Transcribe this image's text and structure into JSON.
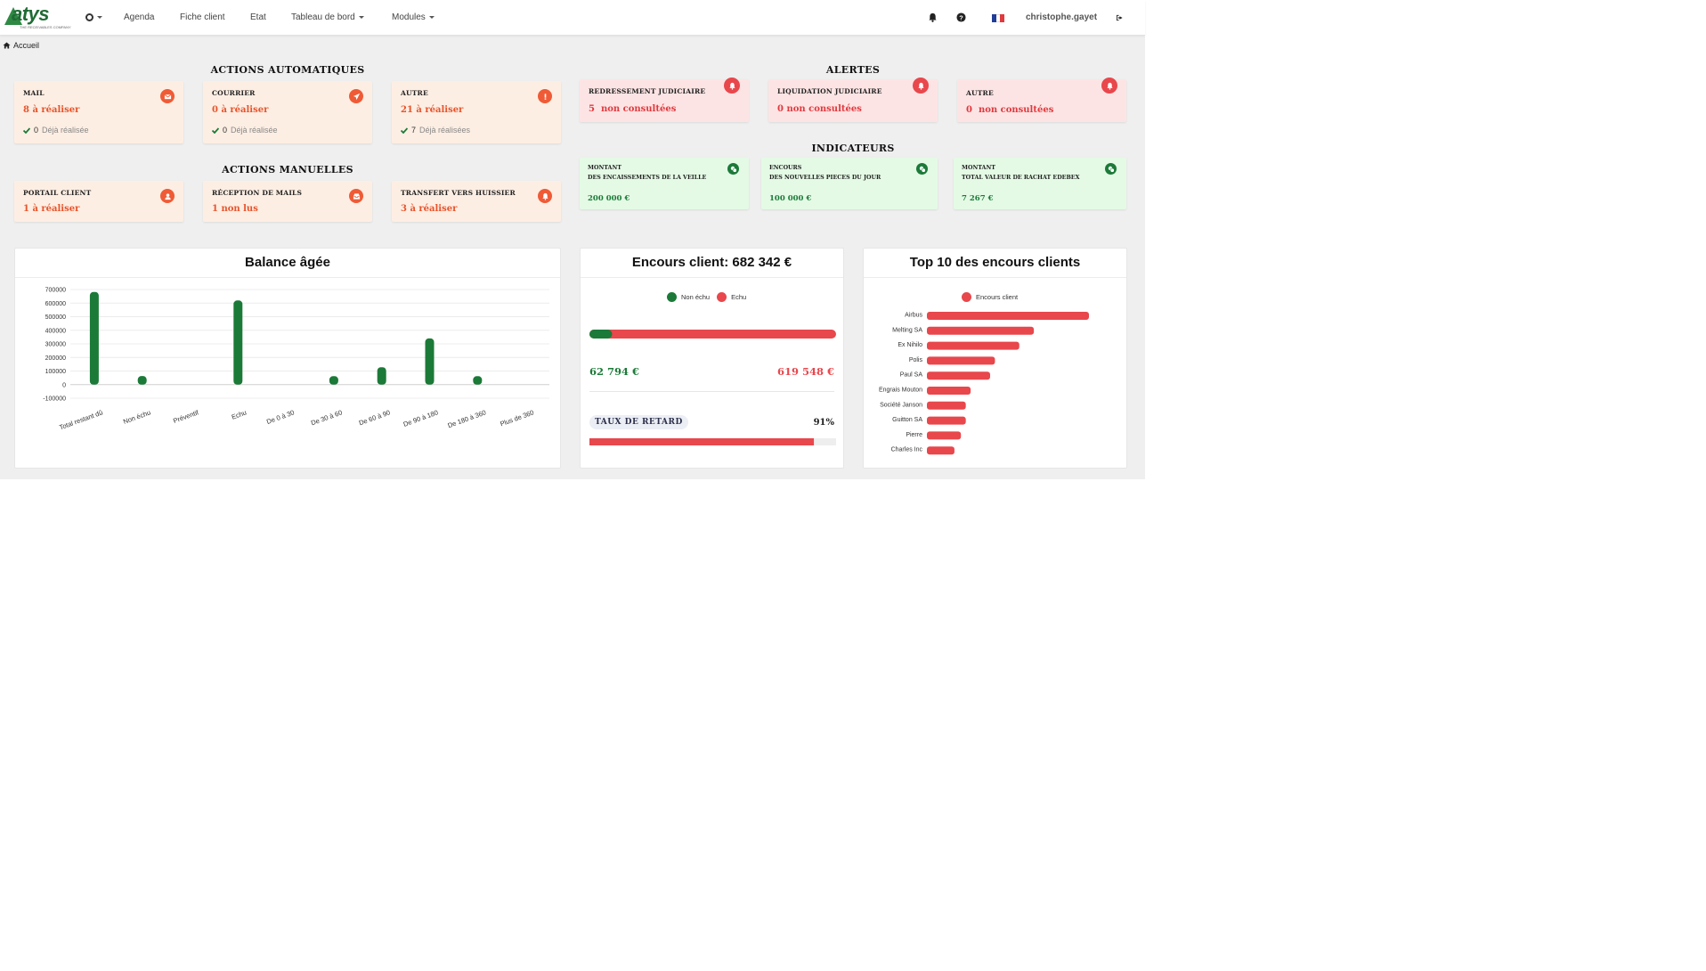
{
  "navbar": {
    "logo_text": "atys",
    "logo_tagline": "THE RECEIVABLES COMPANY",
    "gear_label": "",
    "items": [
      "Agenda",
      "Fiche client",
      "Etat",
      "Tableau de bord",
      "Modules"
    ],
    "user": "christophe.gayet",
    "icons": [
      "bell-icon",
      "help-icon",
      "flag-fr-icon",
      "logout-icon"
    ],
    "flag_colors": [
      "#1f3d99",
      "#ffffff",
      "#e0393e"
    ]
  },
  "breadcrumb": {
    "label": "Accueil",
    "icon": "home-icon"
  },
  "sections": {
    "actions_auto": "ACTIONS AUTOMATIQUES",
    "actions_manual": "ACTIONS MANUELLES",
    "alerts": "ALERTES",
    "indicators": "INDICATEURS"
  },
  "actions_auto": [
    {
      "title": "MAIL",
      "value": "8 à réaliser",
      "done_count": "0",
      "done_label": "Déjà réalisée",
      "icon": "envelope-icon"
    },
    {
      "title": "COURRIER",
      "value": "0 à réaliser",
      "done_count": "0",
      "done_label": "Déjà réalisée",
      "icon": "send-icon"
    },
    {
      "title": "AUTRE",
      "value": "21 à réaliser",
      "done_count": "7",
      "done_label": "Déjà réalisées",
      "icon": "exclamation-icon"
    }
  ],
  "actions_manual": [
    {
      "title": "PORTAIL CLIENT",
      "value": "1 à réaliser",
      "icon": "user-icon"
    },
    {
      "title": "RÉCEPTION DE MAILS",
      "value": "1 non lus",
      "icon": "inbox-icon"
    },
    {
      "title": "TRANSFERT VERS HUISSIER",
      "value": "3 à réaliser",
      "icon": "bell-icon"
    }
  ],
  "alerts": [
    {
      "title": "REDRESSEMENT JUDICIAIRE",
      "count": "5",
      "label": "non consultées"
    },
    {
      "title": "LIQUIDATION JUDICIAIRE",
      "count": "0",
      "label": "non consultées"
    },
    {
      "title": "AUTRE",
      "count": "0",
      "label": "non consultées"
    }
  ],
  "indicators": [
    {
      "line1": "MONTANT",
      "line2": "DES ENCAISSEMENTS   DE LA VEILLE",
      "value": "200 000 €"
    },
    {
      "line1": "ENCOURS",
      "line2": "DES NOUVELLES  PIECES  DU JOUR",
      "value": "100 000 €"
    },
    {
      "line1": "MONTANT",
      "line2": "TOTAL  VALEUR   DE RACHAT  EDEBEX",
      "value": "7 267 €"
    }
  ],
  "colors": {
    "orange": "#ef5b36",
    "red": "#e8474c",
    "green": "#1b7a38",
    "bar_red": "#e8474c"
  },
  "balance": {
    "title": "Balance âgée",
    "chart_data": {
      "type": "bar",
      "title": "Balance âgée",
      "categories": [
        "Total restant dû",
        "Non échu",
        "Préventif",
        "Echu",
        "De 0 à 30",
        "De 30 à 60",
        "De 60 à 90",
        "De 90 à 180",
        "De 180 à 360",
        "Plus de 360"
      ],
      "values": [
        682342,
        62794,
        0,
        619548,
        0,
        62000,
        128000,
        340000,
        62000,
        0
      ],
      "yticks": [
        "700000",
        "600000",
        "500000",
        "400000",
        "300000",
        "200000",
        "100000",
        "0",
        "-100000"
      ],
      "ylim": [
        -100000,
        700000
      ],
      "color": "#1b7a38"
    }
  },
  "encours": {
    "title": "Encours client: 682 342 €",
    "legend": [
      {
        "label": "Non échu",
        "color": "#1b7a38"
      },
      {
        "label": "Echu",
        "color": "#e8474c"
      }
    ],
    "chart_data": {
      "type": "bar",
      "series": [
        {
          "name": "Non échu",
          "values": [
            62794
          ]
        },
        {
          "name": "Echu",
          "values": [
            619548
          ]
        }
      ]
    },
    "non_echu_value": "62 794 €",
    "echu_value": "619 548 €",
    "taux_label": "TAUX DE RETARD",
    "taux_value": "91%",
    "taux_fraction": 0.91
  },
  "top10": {
    "title": "Top 10 des encours clients",
    "legend": "Encours client",
    "chart_data": {
      "type": "bar",
      "orientation": "horizontal",
      "categories": [
        "Airbus",
        "Melting SA",
        "Ex Nihilo",
        "Polis",
        "Paul SA",
        "Engrais Mouton",
        "Société Janson",
        "Guitton SA",
        "Pierre",
        "Charles Inc"
      ],
      "values": [
        100,
        66,
        57,
        42,
        39,
        27,
        24,
        24,
        21,
        17
      ],
      "series": [
        {
          "name": "Encours client",
          "values": [
            100,
            66,
            57,
            42,
            39,
            27,
            24,
            24,
            21,
            17
          ]
        }
      ],
      "color": "#e8474c"
    }
  }
}
